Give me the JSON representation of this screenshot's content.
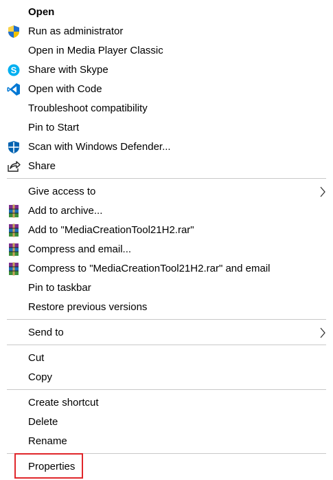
{
  "menu": {
    "open": "Open",
    "run_as_admin": "Run as administrator",
    "open_mpc": "Open in Media Player Classic",
    "share_skype": "Share with Skype",
    "open_code": "Open with Code",
    "troubleshoot": "Troubleshoot compatibility",
    "pin_start": "Pin to Start",
    "scan_defender": "Scan with Windows Defender...",
    "share": "Share",
    "give_access": "Give access to",
    "add_archive": "Add to archive...",
    "add_to_rar": "Add to \"MediaCreationTool21H2.rar\"",
    "compress_email": "Compress and email...",
    "compress_rar_email": "Compress to \"MediaCreationTool21H2.rar\" and email",
    "pin_taskbar": "Pin to taskbar",
    "restore_versions": "Restore previous versions",
    "send_to": "Send to",
    "cut": "Cut",
    "copy": "Copy",
    "create_shortcut": "Create shortcut",
    "delete": "Delete",
    "rename": "Rename",
    "properties": "Properties"
  },
  "icons": {
    "run_as_admin": "uac-shield-icon",
    "share_skype": "skype-icon",
    "open_code": "vscode-icon",
    "scan_defender": "windows-defender-icon",
    "share": "share-icon",
    "winrar": "winrar-icon",
    "submenu": "chevron-right-icon"
  },
  "colors": {
    "highlight_border": "#e0262a",
    "separator": "#c8c8c8",
    "skype": "#00aff0",
    "vscode": "#0078d4",
    "defender": "#0063b1"
  }
}
